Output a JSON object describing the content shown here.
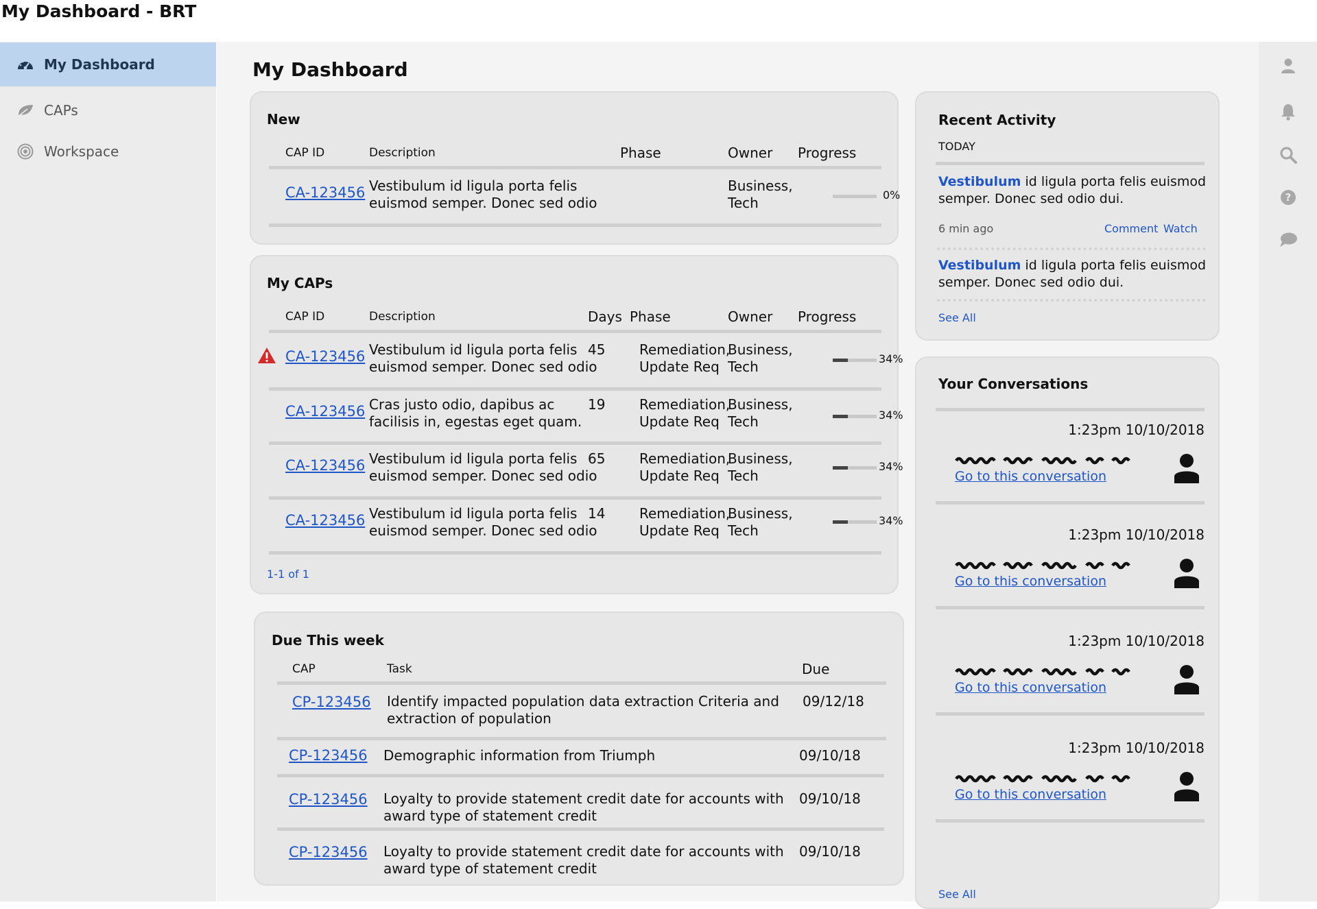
{
  "window": {
    "title": "My Dashboard - BRT"
  },
  "sidebar": {
    "items": [
      {
        "label": "My Dashboard",
        "icon": "dashboard-gauge-icon",
        "active": true
      },
      {
        "label": "CAPs",
        "icon": "leaf-icon",
        "active": false
      },
      {
        "label": "Workspace",
        "icon": "target-icon",
        "active": false
      }
    ]
  },
  "main": {
    "title": "My Dashboard"
  },
  "new_card": {
    "title": "New",
    "headers": {
      "cap_id": "CAP ID",
      "description": "Description",
      "phase": "Phase",
      "owner": "Owner",
      "progress": "Progress"
    },
    "rows": [
      {
        "cap_id": "CA-123456",
        "desc1": "Vestibulum id ligula porta felis",
        "desc2": "euismod semper. Donec sed odio",
        "owner1": "Business,",
        "owner2": "Tech",
        "progress": 0,
        "progress_label": "0%"
      }
    ]
  },
  "my_caps": {
    "title": "My CAPs",
    "headers": {
      "cap_id": "CAP ID",
      "description": "Description",
      "days": "Days",
      "phase": "Phase",
      "owner": "Owner",
      "progress": "Progress"
    },
    "rows": [
      {
        "warning": true,
        "cap_id": "CA-123456",
        "desc1": "Vestibulum id ligula porta felis",
        "desc2": "euismod semper. Donec sed odio",
        "days": "45",
        "phase1": "Remediation,",
        "phase2": "Update Req",
        "owner1": "Business,",
        "owner2": "Tech",
        "progress": 0.34,
        "progress_label": "34%"
      },
      {
        "warning": false,
        "cap_id": "CA-123456",
        "desc1": "Cras justo odio, dapibus ac",
        "desc2": "facilisis in, egestas eget quam.",
        "days": "19",
        "phase1": "Remediation,",
        "phase2": "Update Req",
        "owner1": "Business,",
        "owner2": "Tech",
        "progress": 0.34,
        "progress_label": "34%"
      },
      {
        "warning": false,
        "cap_id": "CA-123456",
        "desc1": "Vestibulum id ligula porta felis",
        "desc2": "euismod semper. Donec sed odio",
        "days": "65",
        "phase1": "Remediation,",
        "phase2": "Update Req",
        "owner1": "Business,",
        "owner2": "Tech",
        "progress": 0.34,
        "progress_label": "34%"
      },
      {
        "warning": false,
        "cap_id": "CA-123456",
        "desc1": "Vestibulum id ligula porta felis",
        "desc2": "euismod semper. Donec sed odio",
        "days": "14",
        "phase1": "Remediation,",
        "phase2": "Update Req",
        "owner1": "Business,",
        "owner2": "Tech",
        "progress": 0.34,
        "progress_label": "34%"
      }
    ],
    "pagination": "1-1 of 1"
  },
  "due_week": {
    "title": "Due This week",
    "headers": {
      "cap": "CAP",
      "task": "Task",
      "due": "Due"
    },
    "rows": [
      {
        "cap": "CP-123456",
        "task1": "Identify impacted population data extraction Criteria and",
        "task2": "extraction of population",
        "due": "09/12/18"
      },
      {
        "cap": "CP-123456",
        "task1": "Demographic information from Triumph",
        "task2": "",
        "due": "09/10/18"
      },
      {
        "cap": "CP-123456",
        "task1": "Loyalty to provide statement credit date for accounts with",
        "task2": "award type of statement credit",
        "due": "09/10/18"
      },
      {
        "cap": "CP-123456",
        "task1": "Loyalty to provide statement credit date for accounts with",
        "task2": "award type of statement credit",
        "due": "09/10/18"
      }
    ]
  },
  "recent_activity": {
    "title": "Recent Activity",
    "group": "TODAY",
    "items": [
      {
        "highlight": "Vestibulum",
        "text1": " id ligula porta felis euismod",
        "text2": "semper. Donec sed odio dui.",
        "time": "6 min ago",
        "comment": "Comment",
        "watch": "Watch"
      },
      {
        "highlight": "Vestibulum",
        "text1": " id ligula porta felis euismod",
        "text2": "semper. Donec sed odio dui."
      }
    ],
    "see_all": "See All"
  },
  "conversations": {
    "title": "Your Conversations",
    "items": [
      {
        "time": "1:23pm 10/10/2018",
        "link": "Go to this conversation"
      },
      {
        "time": "1:23pm 10/10/2018",
        "link": "Go to this conversation"
      },
      {
        "time": "1:23pm 10/10/2018",
        "link": "Go to this conversation"
      },
      {
        "time": "1:23pm 10/10/2018",
        "link": "Go to this conversation"
      }
    ],
    "see_all": "See All"
  },
  "right_rail": {
    "icons": [
      "user-icon",
      "bell-icon",
      "search-icon",
      "help-icon",
      "chat-icon"
    ]
  }
}
